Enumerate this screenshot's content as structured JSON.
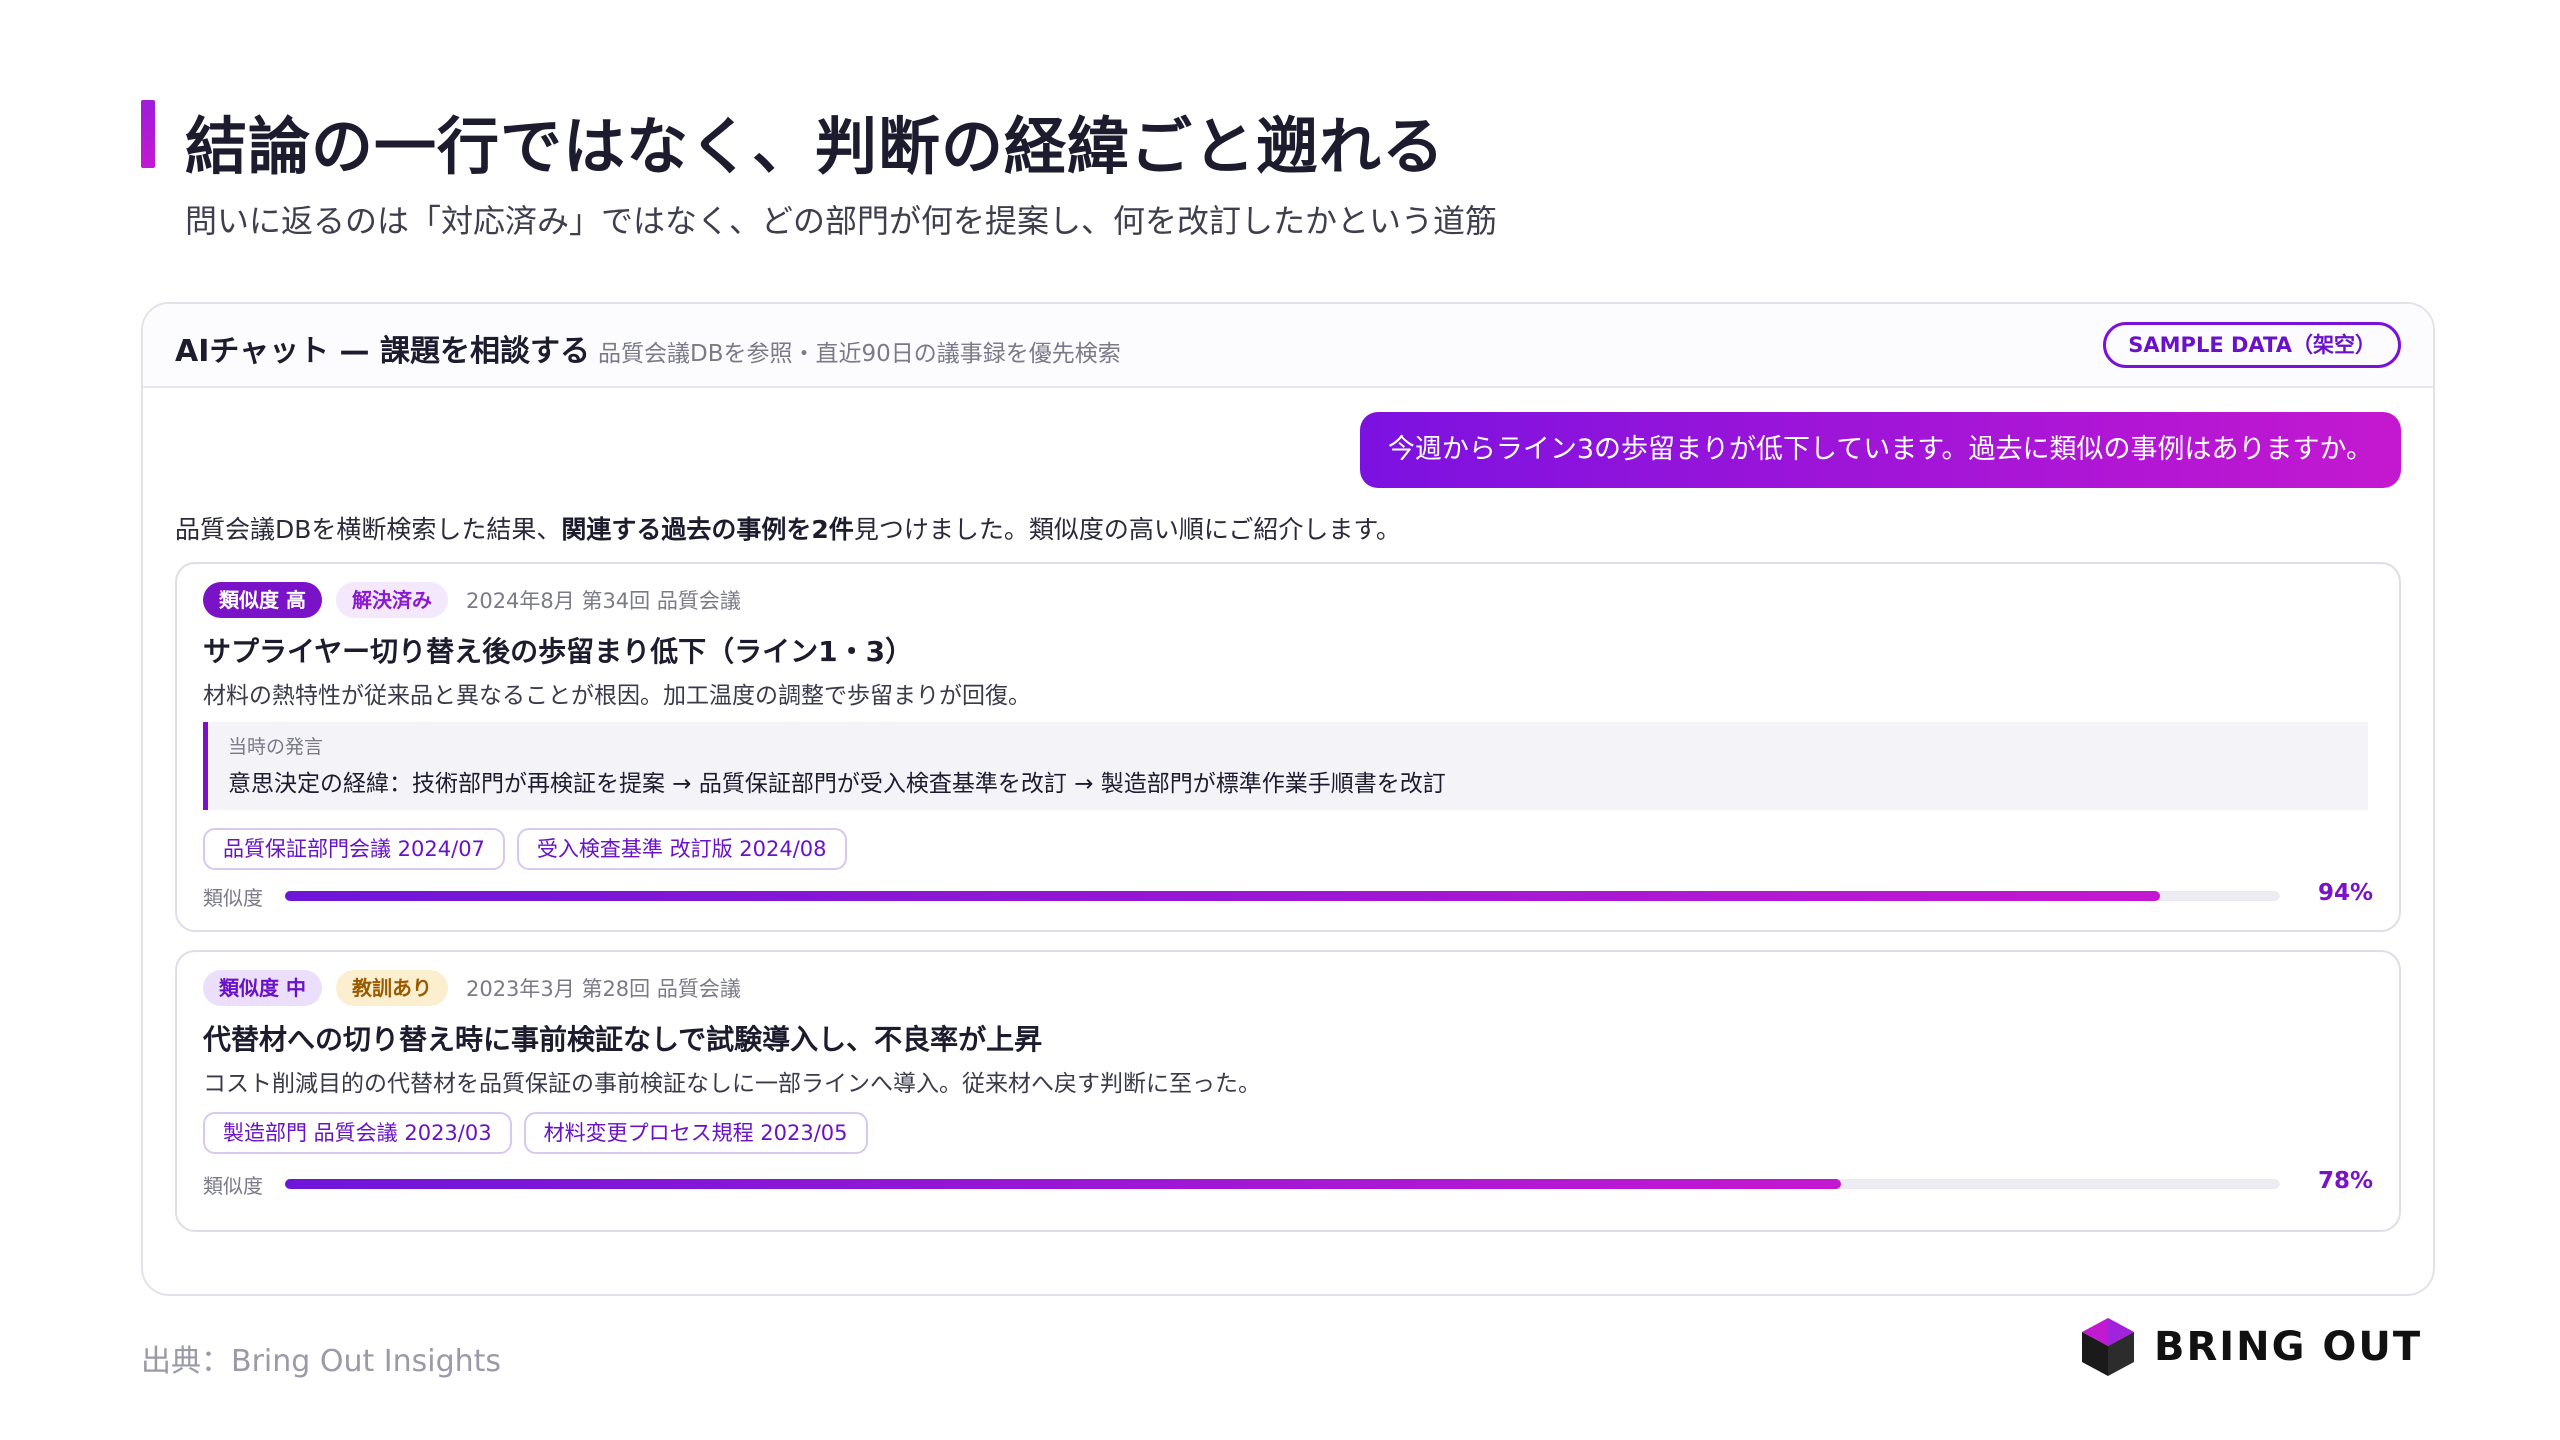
{
  "slide": {
    "title": "結論の一行ではなく、判断の経緯ごと遡れる",
    "subtitle": "問いに返るのは「対応済み」ではなく、どの部門が何を提案し、何を改訂したかという道筋"
  },
  "panel": {
    "title": "AIチャット — 課題を相談する",
    "description": "品質会議DBを参照・直近90日の議事録を優先検索",
    "badge": "SAMPLE DATA（架空）"
  },
  "chat": {
    "user_message": "今週からライン3の歩留まりが低下しています。過去に類似の事例はありますか。",
    "answer_prefix": "品質会議DBを横断検索した結果、",
    "answer_bold": "関連する過去の事例を2件",
    "answer_suffix": "見つけました。類似度の高い順にご紹介します。"
  },
  "cases": [
    {
      "similarity_tag": "類似度 高",
      "status_tag": "解決済み",
      "meta": "2024年8月 第34回 品質会議",
      "title": "サプライヤー切り替え後の歩留まり低下（ライン1・3）",
      "description": "材料の熱特性が従来品と異なることが根因。加工温度の調整で歩留まりが回復。",
      "quote_label": "当時の発言",
      "quote_text": "意思決定の経緯：技術部門が再検証を提案 → 品質保証部門が受入検査基準を改訂 → 製造部門が標準作業手順書を改訂",
      "chips": [
        "品質保証部門会議 2024/07",
        "受入検査基準 改訂版 2024/08"
      ],
      "similarity_label": "類似度",
      "similarity_value": 94,
      "similarity_text": "94%"
    },
    {
      "similarity_tag": "類似度 中",
      "status_tag": "教訓あり",
      "meta": "2023年3月 第28回 品質会議",
      "title": "代替材への切り替え時に事前検証なしで試験導入し、不良率が上昇",
      "description": "コスト削減目的の代替材を品質保証の事前検証なしに一部ラインへ導入。従来材へ戻す判断に至った。",
      "chips": [
        "製造部門 品質会議 2023/03",
        "材料変更プロセス規程 2023/05"
      ],
      "similarity_label": "類似度",
      "similarity_value": 78,
      "similarity_text": "78%"
    }
  ],
  "footer": {
    "source": "出典：Bring Out Insights",
    "brand": "BRING OUT"
  },
  "colors": {
    "accent": "#7a12c8",
    "gradient_start": "#7c12e0",
    "gradient_end": "#c418d0"
  }
}
